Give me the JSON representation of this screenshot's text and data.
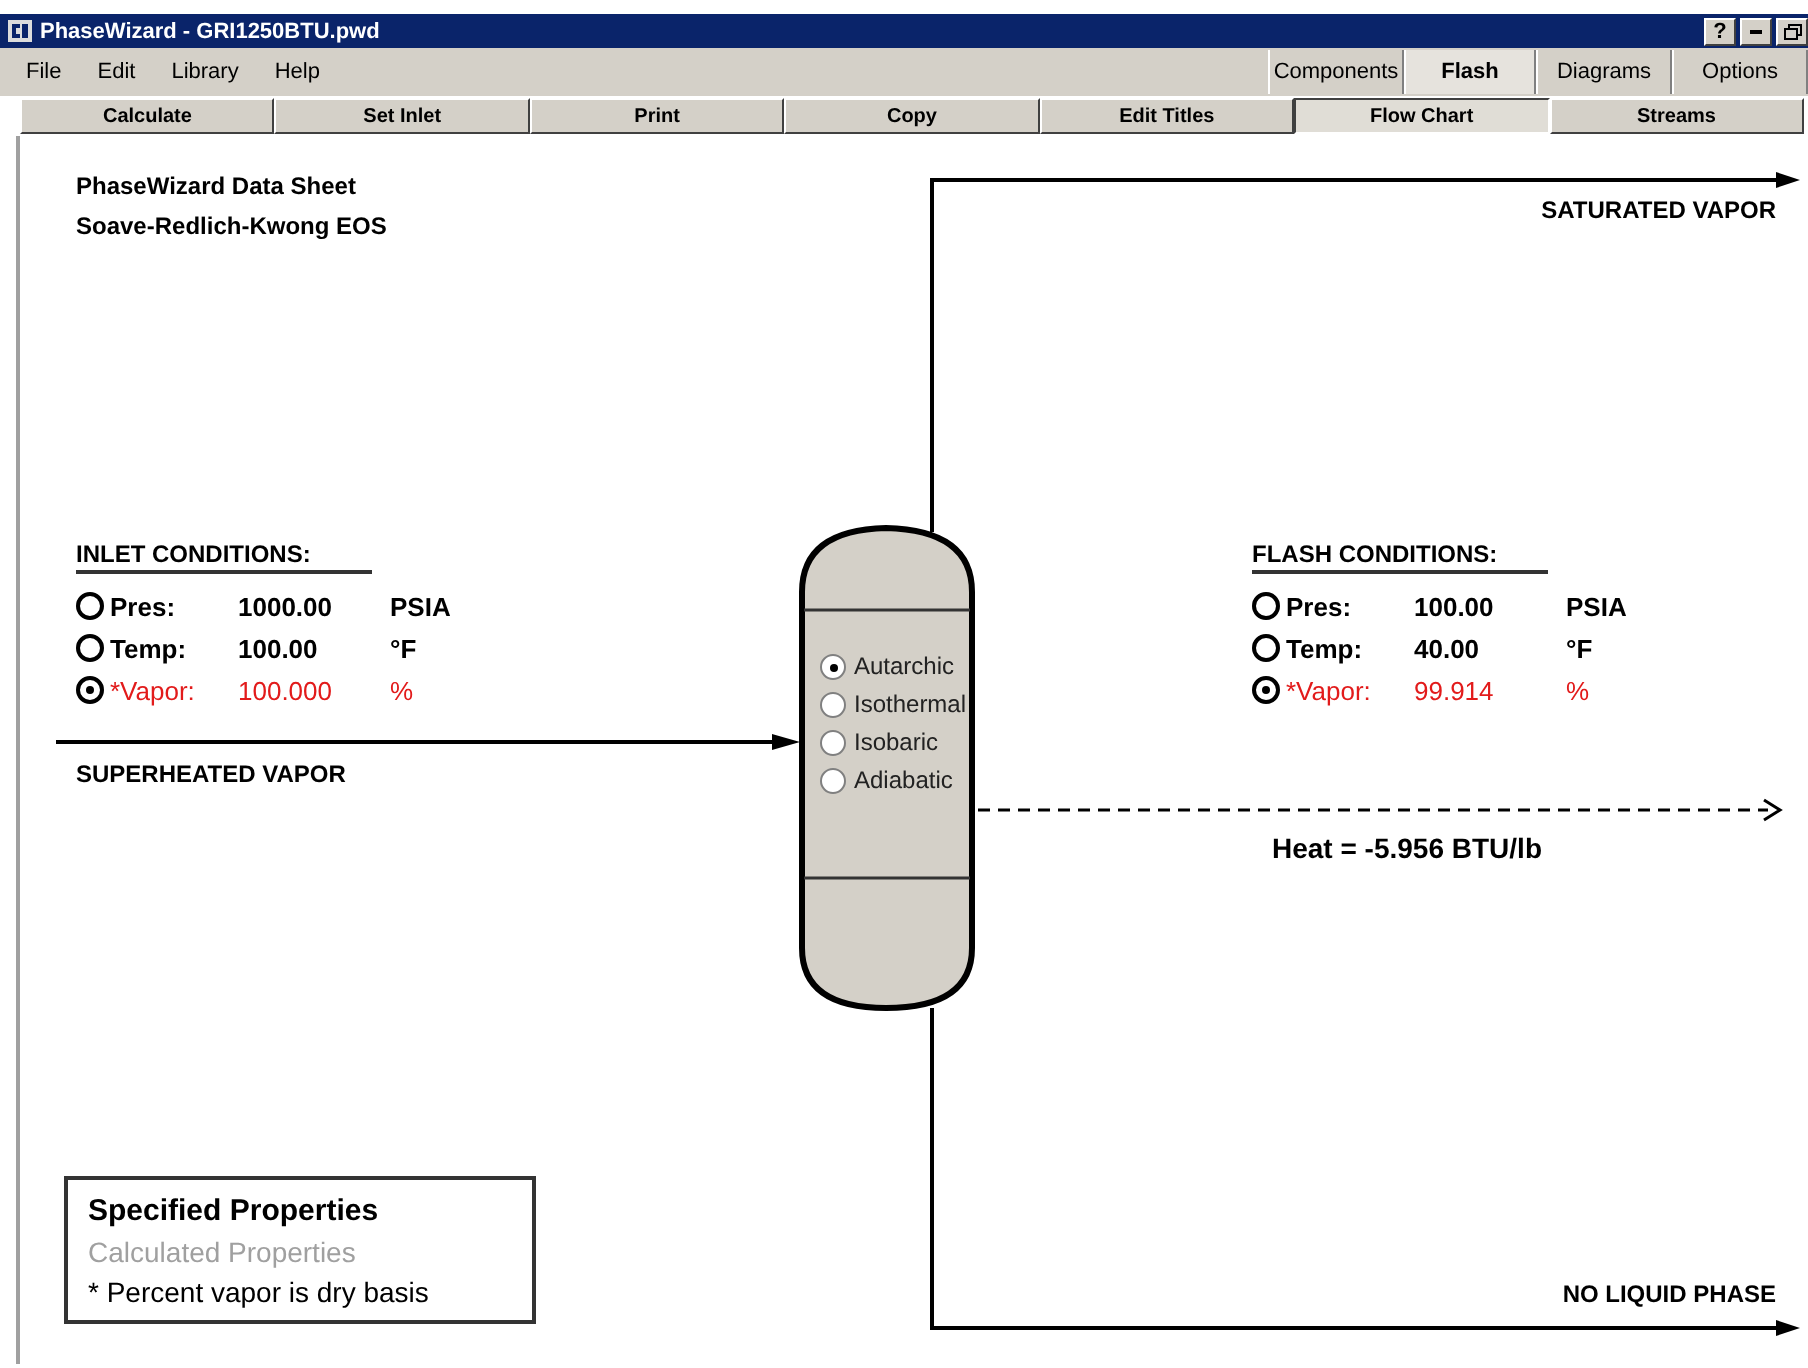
{
  "window": {
    "title": "PhaseWizard - GRI1250BTU.pwd",
    "help_button": "?"
  },
  "menu": [
    "File",
    "Edit",
    "Library",
    "Help"
  ],
  "view_tabs": [
    {
      "label": "Components",
      "selected": false
    },
    {
      "label": "Flash",
      "selected": true
    },
    {
      "label": "Diagrams",
      "selected": false
    },
    {
      "label": "Options",
      "selected": false
    }
  ],
  "toolbar": [
    {
      "label": "Calculate",
      "selected": false
    },
    {
      "label": "Set Inlet",
      "selected": false
    },
    {
      "label": "Print",
      "selected": false
    },
    {
      "label": "Copy",
      "selected": false
    },
    {
      "label": "Edit Titles",
      "selected": false
    },
    {
      "label": "Flow Chart",
      "selected": true
    },
    {
      "label": "Streams",
      "selected": false
    }
  ],
  "sheet": {
    "title": "PhaseWizard Data Sheet",
    "subtitle": "Soave-Redlich-Kwong EOS"
  },
  "inlet": {
    "heading": "INLET CONDITIONS:",
    "stream": "SUPERHEATED VAPOR",
    "rows": [
      {
        "label": "Pres:",
        "value": "1000.00",
        "unit": "PSIA",
        "selected": false,
        "kind": "specified"
      },
      {
        "label": "Temp:",
        "value": "100.00",
        "unit": "°F",
        "selected": false,
        "kind": "specified"
      },
      {
        "label": "*Vapor:",
        "value": "100.000",
        "unit": "%",
        "selected": true,
        "kind": "vapor"
      }
    ]
  },
  "flash": {
    "heading": "FLASH CONDITIONS:",
    "heat": "Heat = -5.956 BTU/lb",
    "rows": [
      {
        "label": "Pres:",
        "value": "100.00",
        "unit": "PSIA",
        "selected": false,
        "kind": "specified"
      },
      {
        "label": "Temp:",
        "value": "40.00",
        "unit": "°F",
        "selected": false,
        "kind": "specified"
      },
      {
        "label": "*Vapor:",
        "value": "99.914",
        "unit": "%",
        "selected": true,
        "kind": "vapor"
      }
    ]
  },
  "vessel_modes": [
    {
      "label": "Autarchic",
      "selected": true
    },
    {
      "label": "Isothermal",
      "selected": false
    },
    {
      "label": "Isobaric",
      "selected": false
    },
    {
      "label": "Adiabatic",
      "selected": false
    }
  ],
  "outlets": {
    "top": "SATURATED VAPOR",
    "bottom": "NO LIQUID PHASE"
  },
  "legend": [
    "Specified Properties",
    "Calculated Properties",
    "* Percent vapor is dry basis"
  ]
}
